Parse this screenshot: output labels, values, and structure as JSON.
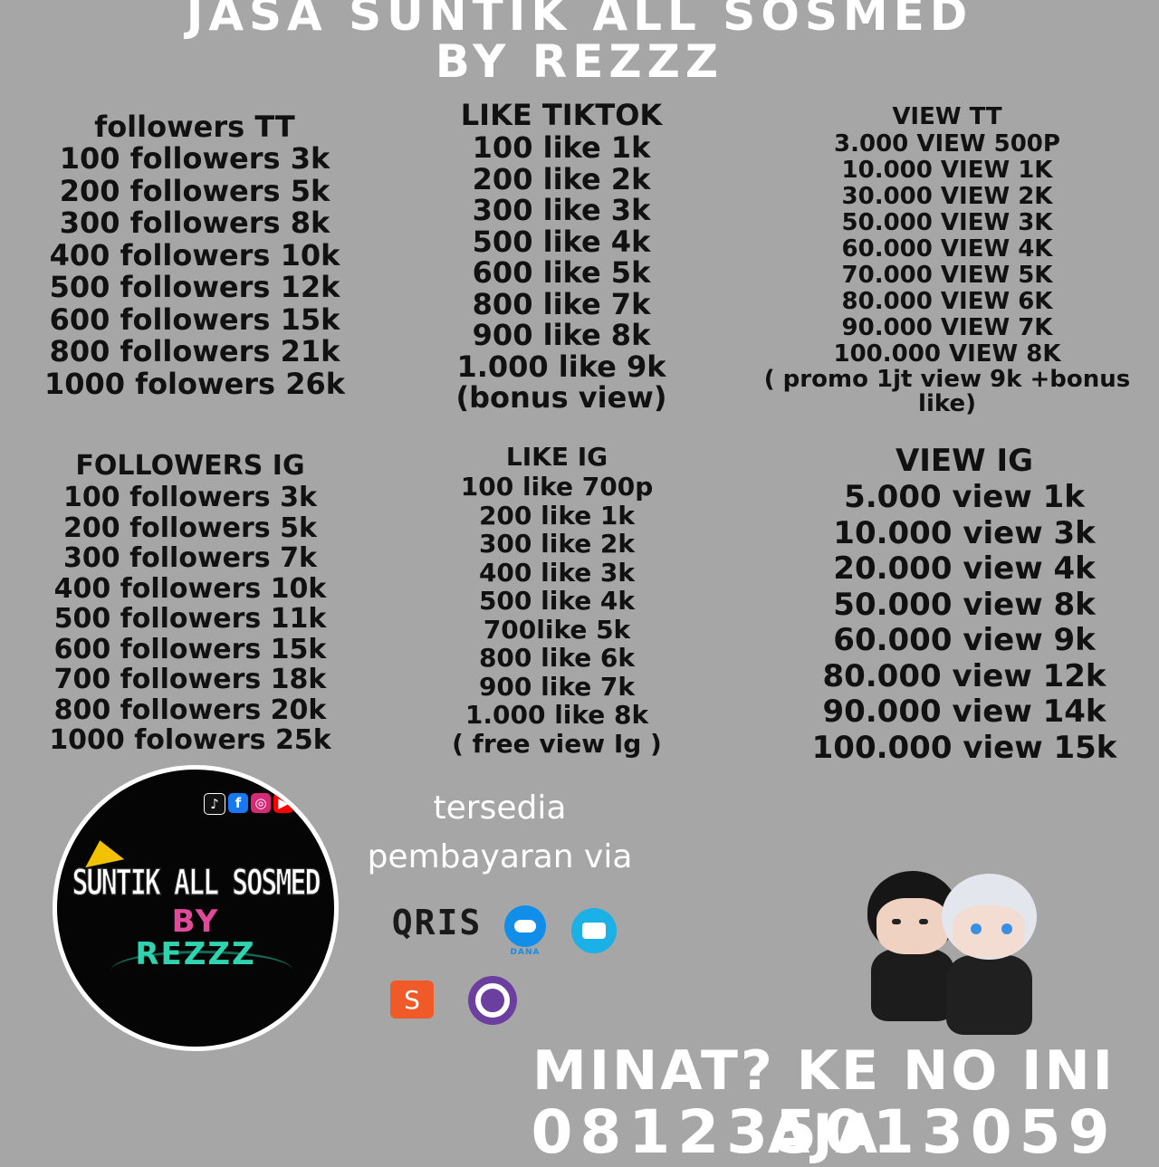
{
  "header": {
    "line1": "JASA SUNTIK ALL SOSMED",
    "line2": "BY REZZZ"
  },
  "followers_tt": {
    "heading": "followers TT",
    "rows": [
      "100 followers 3k",
      "200 followers 5k",
      "300 followers 8k",
      "400 followers 10k",
      "500 followers 12k",
      "600 followers 15k",
      "800 followers 21k",
      "1000 folowers 26k"
    ]
  },
  "like_tiktok": {
    "heading": "LIKE TIKTOK",
    "rows": [
      "100 like 1k",
      "200 like 2k",
      "300 like 3k",
      "500 like 4k",
      "600 like 5k",
      "800 like 7k",
      "900 like 8k",
      "1.000 like 9k",
      "(bonus view)"
    ]
  },
  "view_tt": {
    "heading": "VIEW TT",
    "rows": [
      "3.000 VIEW 500P",
      "10.000 VIEW 1K",
      "30.000 VIEW 2K",
      "50.000 VIEW 3K",
      "60.000 VIEW 4K",
      "70.000 VIEW 5K",
      "80.000 VIEW 6K",
      "90.000 VIEW 7K",
      "100.000 VIEW 8K"
    ],
    "note": "( promo 1jt view 9k +bonus like)"
  },
  "followers_ig": {
    "heading": "FOLLOWERS IG",
    "rows": [
      "100 followers 3k",
      "200 followers 5k",
      "300 followers 7k",
      "400 followers 10k",
      "500 followers 11k",
      "600 followers 15k",
      "700 followers 18k",
      "800 followers 20k",
      "1000 folowers 25k"
    ]
  },
  "like_ig": {
    "heading": "LIKE IG",
    "rows": [
      "100 like 700p",
      "200 like 1k",
      "300 like 2k",
      "400 like 3k",
      "500 like 4k",
      "700like 5k",
      "800 like 6k",
      "900 like 7k",
      "1.000 like 8k",
      "( free view Ig )"
    ]
  },
  "view_ig": {
    "heading": "VIEW IG",
    "rows": [
      "5.000 view 1k",
      "10.000 view 3k",
      "20.000 view 4k",
      "50.000 view 8k",
      "60.000 view 9k",
      "80.000 view 12k",
      "90.000 view 14k",
      "100.000 view 15k"
    ]
  },
  "logo": {
    "line1": "SUNTIK ALL SOSMED",
    "line2": "BY",
    "line3": "REZZZ",
    "social_icons": [
      "tiktok-icon",
      "facebook-icon",
      "instagram-icon",
      "youtube-icon"
    ]
  },
  "payment": {
    "line1": "tersedia",
    "line2": "pembayaran via",
    "qris": "QRIS",
    "dana": "DANA",
    "spay_glyph": "S"
  },
  "footer": {
    "line1": "MINAT? KE NO INI AJA",
    "line2": "081235013059"
  },
  "colors": {
    "background": "#a6a6a6",
    "text_dark": "#111111",
    "text_light": "#ffffff"
  }
}
